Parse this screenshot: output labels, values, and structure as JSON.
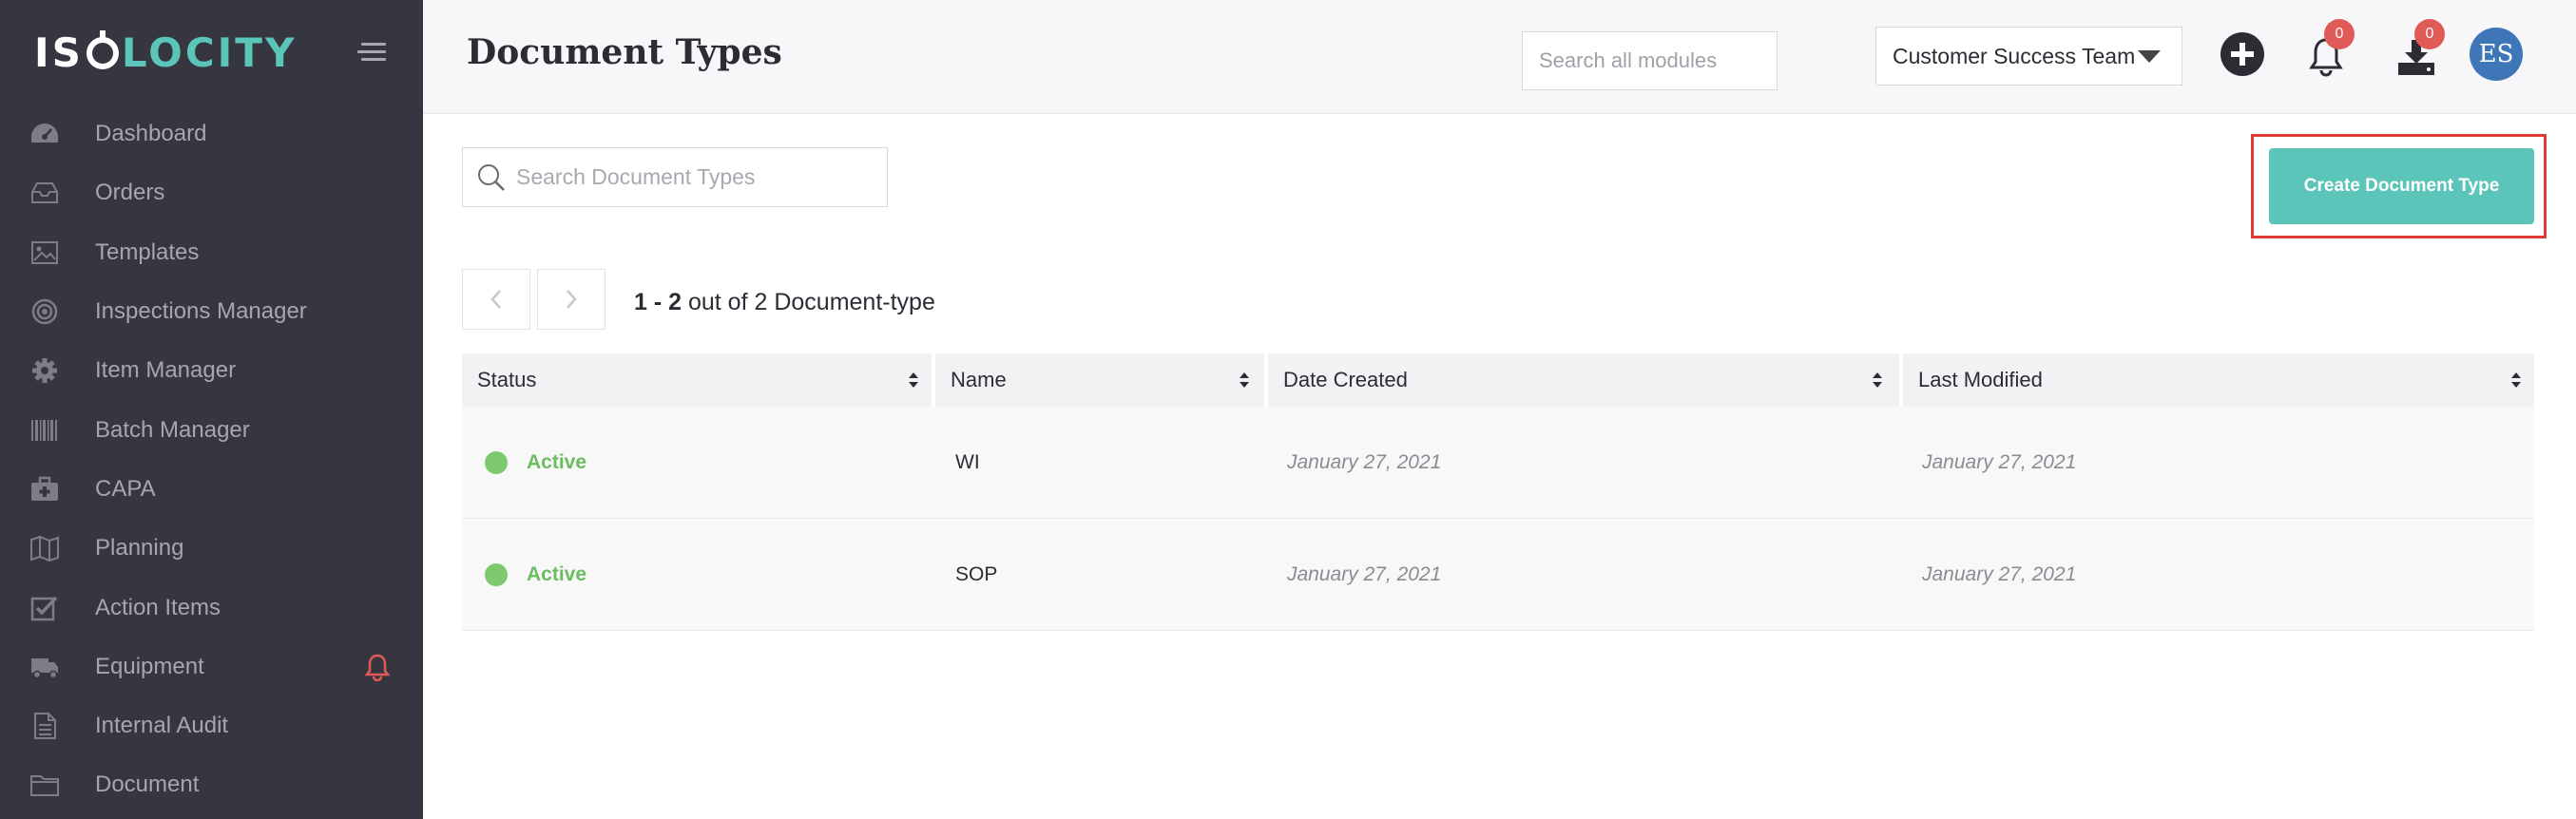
{
  "brand": {
    "part1": "IS",
    "part2": "LOCITY"
  },
  "sidebar": {
    "items": [
      {
        "label": "Dashboard",
        "icon": "dashboard-icon"
      },
      {
        "label": "Orders",
        "icon": "inbox-icon"
      },
      {
        "label": "Templates",
        "icon": "image-icon"
      },
      {
        "label": "Inspections Manager",
        "icon": "target-icon"
      },
      {
        "label": "Item Manager",
        "icon": "gear-icon"
      },
      {
        "label": "Batch Manager",
        "icon": "barcode-icon"
      },
      {
        "label": "CAPA",
        "icon": "medkit-icon"
      },
      {
        "label": "Planning",
        "icon": "map-icon"
      },
      {
        "label": "Action Items",
        "icon": "checkbox-icon"
      },
      {
        "label": "Equipment",
        "icon": "truck-icon"
      },
      {
        "label": "Internal Audit",
        "icon": "file-icon"
      },
      {
        "label": "Document",
        "icon": "folder-icon"
      }
    ]
  },
  "header": {
    "title": "Document Types",
    "module_search_placeholder": "Search all modules",
    "team": "Customer Success Team",
    "notifications_count": "0",
    "downloads_count": "0",
    "avatar_initials": "ES"
  },
  "content": {
    "search_placeholder": "Search Document Types",
    "create_button": "Create Document Type",
    "pagination": {
      "range": "1 - 2",
      "suffix": "out of 2 Document-type"
    }
  },
  "table": {
    "columns": [
      "Status",
      "Name",
      "Date Created",
      "Last Modified"
    ],
    "rows": [
      {
        "status": "Active",
        "name": "WI",
        "date_created": "January 27, 2021",
        "last_modified": "January 27, 2021"
      },
      {
        "status": "Active",
        "name": "SOP",
        "date_created": "January 27, 2021",
        "last_modified": "January 27, 2021"
      }
    ]
  },
  "colors": {
    "sidebar_bg": "#363641",
    "accent_teal": "#5cc5b9",
    "status_green": "#7dc96e",
    "badge_red": "#e05a58",
    "highlight_red": "#e03c31",
    "avatar_blue": "#3f76b8"
  }
}
